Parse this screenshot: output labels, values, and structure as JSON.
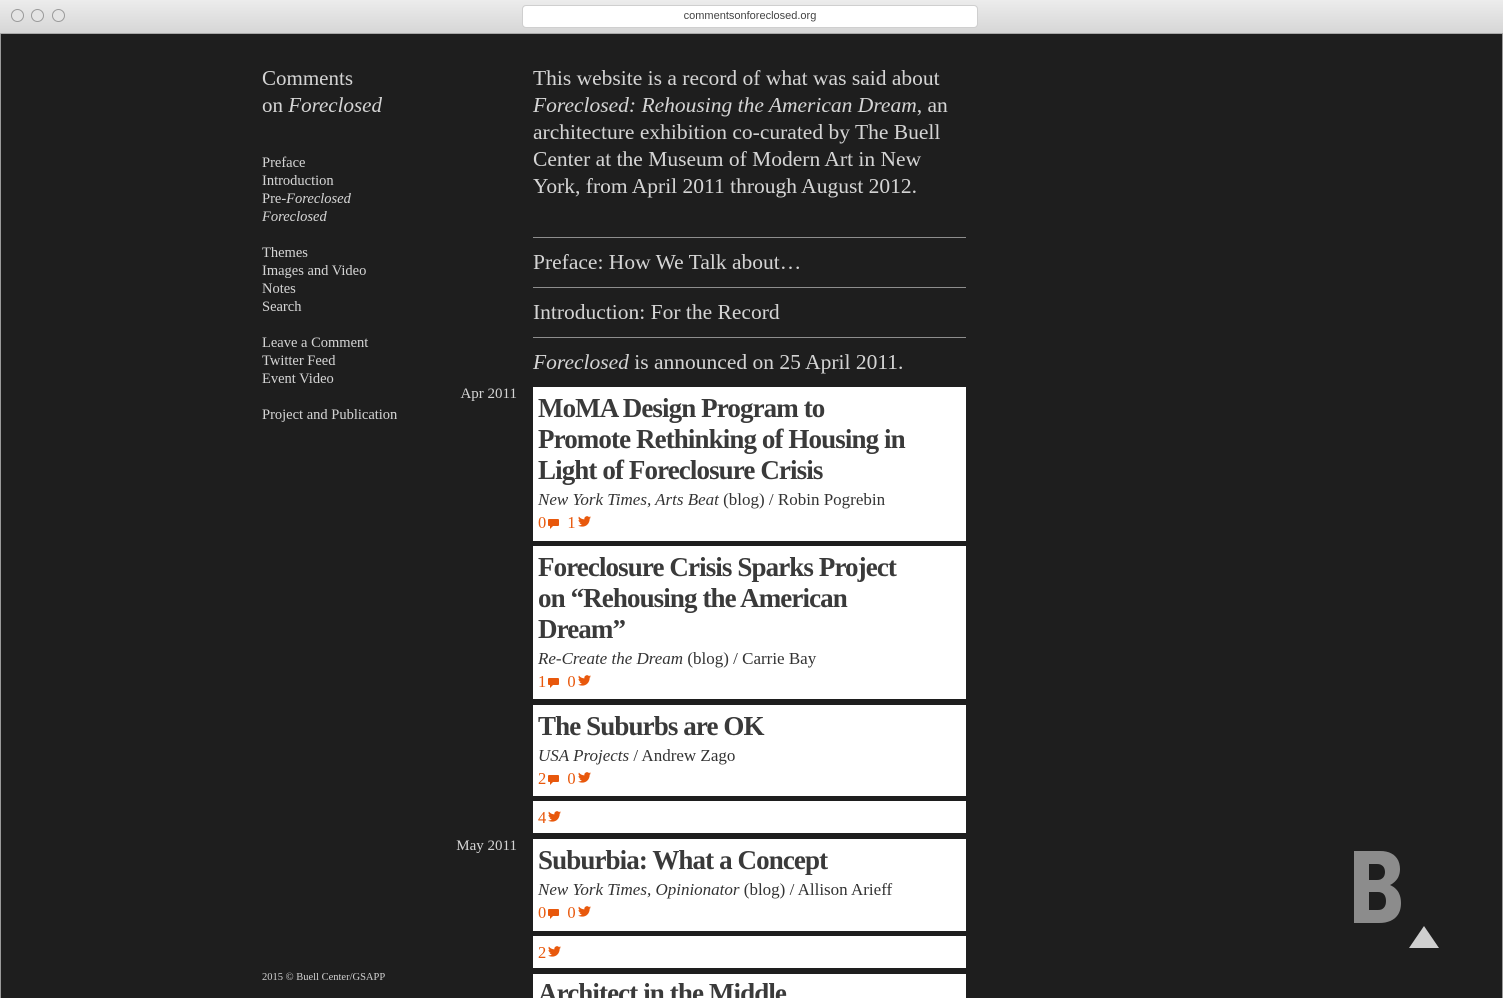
{
  "browser": {
    "url": "commentsonforeclosed.org"
  },
  "site": {
    "title_line1": "Comments",
    "title_prefix": "on ",
    "title_em": "Foreclosed"
  },
  "nav": {
    "group1": {
      "preface": "Preface",
      "introduction": "Introduction",
      "pre_prefix": "Pre-",
      "pre_em": "Foreclosed",
      "foreclosed": "Foreclosed"
    },
    "group2": [
      "Themes",
      "Images and Video",
      "Notes",
      "Search"
    ],
    "group3": [
      "Leave a Comment",
      "Twitter Feed",
      "Event Video"
    ],
    "group4": [
      "Project and Publication"
    ]
  },
  "footer": "2015 © Buell Center/GSAPP",
  "intro": {
    "p1": "This website is a record of what was said about ",
    "em": "Foreclosed: Rehousing the American Dream",
    "p2": ", an architecture exhibition co-curated by The Buell Center at the Museum of Modern Art in New York, from April 2011 through August 2012."
  },
  "sections": {
    "preface": "Preface: How We Talk about…",
    "introduction": "Introduction: For the Record"
  },
  "announce": {
    "em": "Foreclosed",
    "rest": " is announced on 25 April 2011."
  },
  "dates": {
    "apr": "Apr 2011",
    "may": "May 2011"
  },
  "entries": [
    {
      "title": "MoMA Design Program to Promote Rethinking of Housing in Light of Foreclosure Crisis",
      "source_em": "New York Times, Arts Beat",
      "source_rest": " (blog) / Robin Pogrebin",
      "comments": "0",
      "tweets": "1"
    },
    {
      "title": "Foreclosure Crisis Sparks Project on “Rehousing the American Dream”",
      "source_em": "Re-Create the Dream",
      "source_rest": " (blog) / Carrie Bay",
      "comments": "1",
      "tweets": "0"
    },
    {
      "title": "The Suburbs are OK",
      "source_em": "USA Projects",
      "source_rest": " / Andrew Zago",
      "comments": "2",
      "tweets": "0"
    },
    {
      "title": "Suburbia: What a Concept",
      "source_em": "New York Times, Opinionator",
      "source_rest": " (blog) / Allison Arieff",
      "comments": "0",
      "tweets": "0"
    },
    {
      "title": "Architect in the Middle"
    }
  ],
  "tweet_bars": [
    "4",
    "2"
  ],
  "icons": {
    "comment": "comment-icon",
    "tweet": "twitter-bird-icon",
    "logo": "buell-b-logo",
    "top": "back-to-top-icon"
  },
  "colors": {
    "background": "#1e1e1e",
    "accent": "#e8580c",
    "card": "#ffffff",
    "text": "#d4d4d4"
  }
}
